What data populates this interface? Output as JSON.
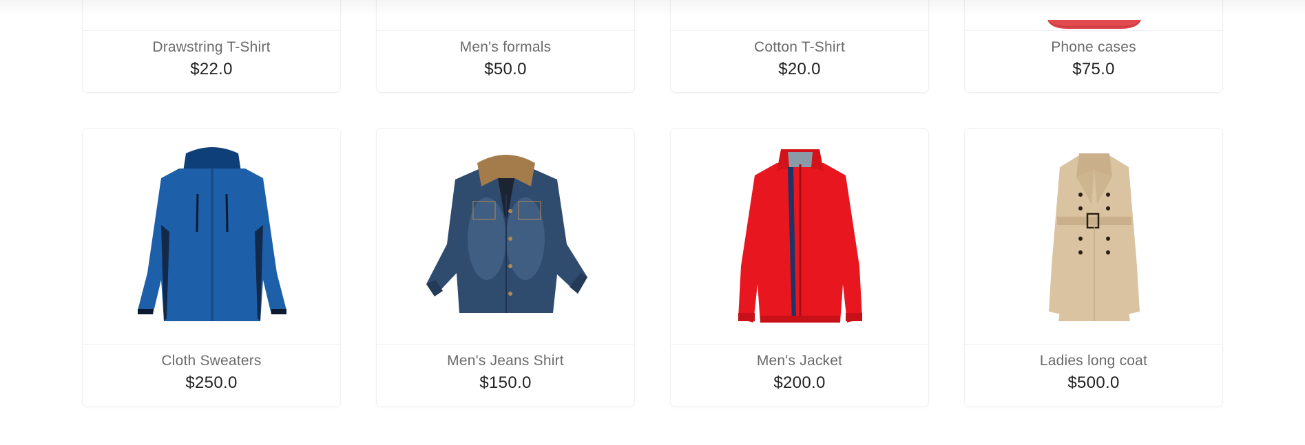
{
  "products_top": [
    {
      "name": "Drawstring T-Shirt",
      "price": "$22.0"
    },
    {
      "name": "Men's formals",
      "price": "$50.0"
    },
    {
      "name": "Cotton T-Shirt",
      "price": "$20.0"
    },
    {
      "name": "Phone cases",
      "price": "$75.0"
    }
  ],
  "products_bottom": [
    {
      "name": "Cloth Sweaters",
      "price": "$250.0",
      "image": "blue-jacket",
      "color": "#1d5fa8"
    },
    {
      "name": "Men's Jeans Shirt",
      "price": "$150.0",
      "image": "denim-jacket",
      "color": "#2f4b6e"
    },
    {
      "name": "Men's Jacket",
      "price": "$200.0",
      "image": "red-jacket",
      "color": "#e8161e"
    },
    {
      "name": "Ladies long coat",
      "price": "$500.0",
      "image": "beige-trench-coat",
      "color": "#d9c3a1"
    }
  ],
  "accent_colors": {
    "phone_case": "#e04a4f",
    "card_border": "#f0f0f0",
    "name_text": "#6a6a6a",
    "price_text": "#222222"
  }
}
